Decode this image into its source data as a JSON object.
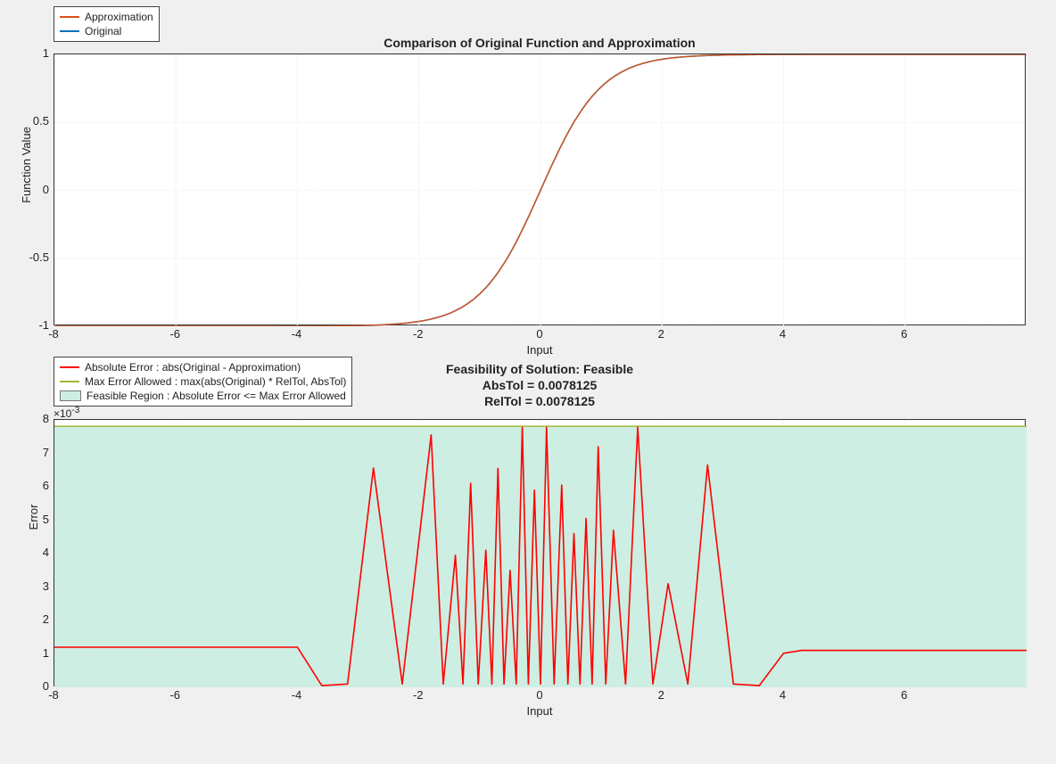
{
  "chart_data": [
    {
      "type": "line",
      "title": "Comparison of Original Function and Approximation",
      "xlabel": "Input",
      "ylabel": "Function Value",
      "xlim": [
        -8,
        8
      ],
      "ylim": [
        -1,
        1
      ],
      "xticks": [
        -8,
        -6,
        -4,
        -2,
        0,
        2,
        4,
        6
      ],
      "yticks": [
        -1,
        -0.5,
        0,
        0.5,
        1
      ],
      "legend": [
        "Approximation",
        "Original"
      ],
      "legend_position": "upper-left",
      "series": [
        {
          "name": "Approximation",
          "color": "#d95319",
          "function": "tanh"
        },
        {
          "name": "Original",
          "color": "#0072bd",
          "function": "tanh"
        }
      ]
    },
    {
      "type": "line",
      "title_lines": [
        "Feasibility of Solution: Feasible",
        "AbsTol = 0.0078125",
        "RelTol = 0.0078125"
      ],
      "xlabel": "Input",
      "ylabel": "Error",
      "xlim": [
        -8,
        8
      ],
      "ylim": [
        0,
        0.008
      ],
      "y_exponent_label": "×10^{-3}",
      "y_exponent": -3,
      "xticks": [
        -8,
        -6,
        -4,
        -2,
        0,
        2,
        4,
        6
      ],
      "yticks": [
        0,
        1,
        2,
        3,
        4,
        5,
        6,
        7,
        8
      ],
      "legend": [
        "Absolute Error : abs(Original - Approximation)",
        "Max Error Allowed : max(abs(Original) * RelTol, AbsTol)",
        "Feasible Region : Absolute Error <= Max Error Allowed"
      ],
      "legend_position": "upper-left",
      "feasible_region": {
        "ymin": 0,
        "ymax": 0.00781,
        "color": "#cdeee2"
      },
      "max_error_line": {
        "value": 0.00781,
        "color": "#a2b83b"
      },
      "abs_error": {
        "color": "#ff0000",
        "baseline": 0.0012,
        "dip_x1": -3.6,
        "dip_x2": 3.6,
        "peaks_x": [
          -2.75,
          -1.8,
          -1.4,
          -1.15,
          -0.9,
          -0.7,
          -0.5,
          -0.3,
          -0.1,
          0.1,
          0.35,
          0.55,
          0.75,
          0.95,
          1.2,
          1.6,
          2.1,
          2.75
        ],
        "peaks_y": [
          0.00656,
          0.00755,
          0.00395,
          0.0061,
          0.0041,
          0.00655,
          0.0035,
          0.00778,
          0.0059,
          0.00778,
          0.00605,
          0.0046,
          0.00505,
          0.0072,
          0.0047,
          0.00778,
          0.0031,
          0.00665
        ]
      }
    }
  ]
}
